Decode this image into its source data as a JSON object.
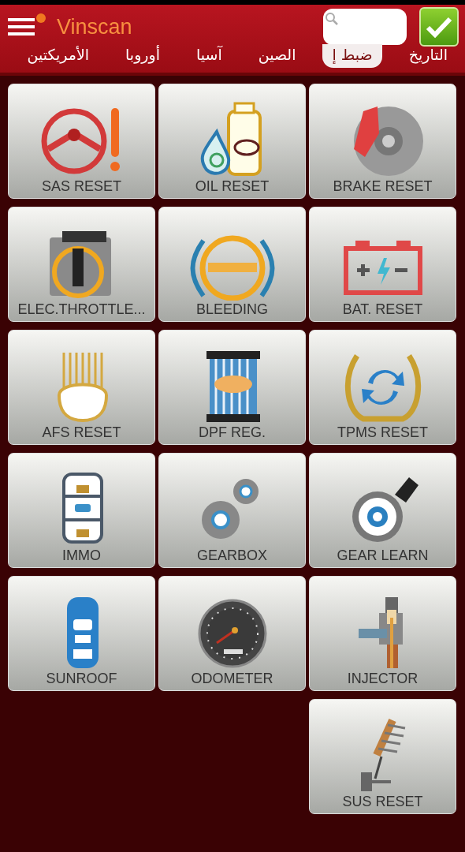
{
  "app_bar": {
    "title": "Vinscan",
    "notification_dot": true,
    "checkbox": {
      "checked": true
    }
  },
  "tabs": [
    {
      "label": "التاريخ",
      "selected": false
    },
    {
      "label": "ضبط إ",
      "selected": true
    },
    {
      "label": "الصين",
      "selected": false
    },
    {
      "label": "آسيا",
      "selected": false
    },
    {
      "label": "أوروبا",
      "selected": false
    },
    {
      "label": "الأمريكتين",
      "selected": false
    }
  ],
  "tiles": [
    {
      "label": "SAS RESET"
    },
    {
      "label": "OIL RESET"
    },
    {
      "label": "BRAKE RESET"
    },
    {
      "label": "ELEC.THROTTLE..."
    },
    {
      "label": "BLEEDING"
    },
    {
      "label": "BAT. RESET"
    },
    {
      "label": "AFS RESET"
    },
    {
      "label": "DPF REG."
    },
    {
      "label": "TPMS RESET"
    },
    {
      "label": "IMMO"
    },
    {
      "label": "GEARBOX"
    },
    {
      "label": "GEAR LEARN"
    },
    {
      "label": "SUNROOF"
    },
    {
      "label": "ODOMETER"
    },
    {
      "label": "INJECTOR"
    },
    {
      "label": "SUS RESET"
    }
  ]
}
